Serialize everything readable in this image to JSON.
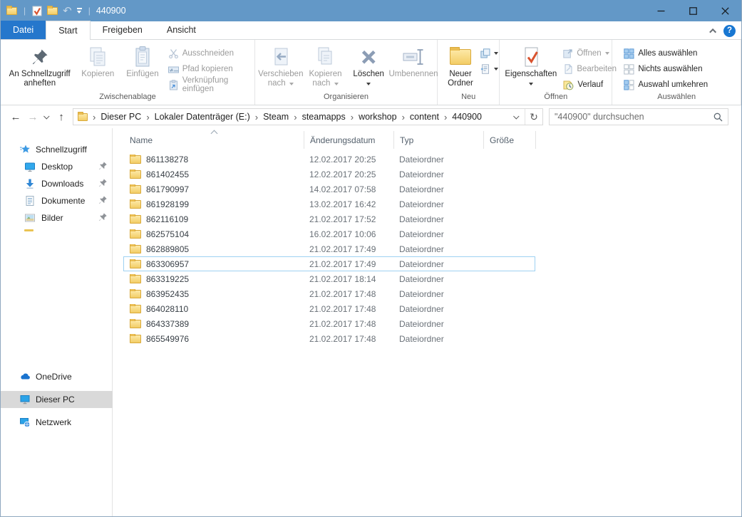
{
  "window": {
    "title": "440900"
  },
  "icons": {
    "back": "←",
    "forward": "→",
    "up": "↑",
    "undo": "↶",
    "refresh": "↻",
    "crumb_separator": "›",
    "help": "?"
  },
  "colors": {
    "titlebar": "#6398c7",
    "file_tab": "#2577cc",
    "selection_outline": "#9ed1f2",
    "folder": "#f3cd66",
    "help_accent": "#1877d2",
    "sidebar_selected": "#d9d9d9"
  },
  "tabs": {
    "datei": "Datei",
    "start": "Start",
    "freigeben": "Freigeben",
    "ansicht": "Ansicht",
    "active": "Start"
  },
  "ribbon": {
    "groups": {
      "clipboard": {
        "label": "Zwischenablage",
        "pin": "An Schnellzugriff anheften",
        "copy": "Kopieren",
        "paste": "Einfügen",
        "cut": "Ausschneiden",
        "copy_path": "Pfad kopieren",
        "paste_shortcut": "Verknüpfung einfügen"
      },
      "organize": {
        "label": "Organisieren",
        "move_to": "Verschieben nach",
        "copy_to": "Kopieren nach",
        "delete": "Löschen",
        "rename": "Umbenennen"
      },
      "new": {
        "label": "Neu",
        "new_folder": "Neuer Ordner"
      },
      "open": {
        "label": "Öffnen",
        "properties": "Eigenschaften",
        "open": "Öffnen",
        "edit": "Bearbeiten",
        "history": "Verlauf"
      },
      "select": {
        "label": "Auswählen",
        "select_all": "Alles auswählen",
        "select_none": "Nichts auswählen",
        "invert": "Auswahl umkehren"
      }
    }
  },
  "navbar": {
    "address": {
      "crumbs": [
        "Dieser PC",
        "Lokaler Datenträger (E:)",
        "Steam",
        "steamapps",
        "workshop",
        "content",
        "440900"
      ]
    },
    "search": {
      "placeholder": "\"440900\" durchsuchen"
    }
  },
  "sidebar": {
    "quick_access": {
      "label": "Schnellzugriff",
      "items": [
        {
          "label": "Desktop",
          "icon": "desktop-icon",
          "pinned": true
        },
        {
          "label": "Downloads",
          "icon": "downloads-icon",
          "pinned": true
        },
        {
          "label": "Dokumente",
          "icon": "documents-icon",
          "pinned": true
        },
        {
          "label": "Bilder",
          "icon": "pictures-icon",
          "pinned": true
        }
      ]
    },
    "one_drive": "OneDrive",
    "this_pc": "Dieser PC",
    "network": "Netzwerk",
    "selected": "Dieser PC"
  },
  "files": {
    "columns": [
      "Name",
      "Änderungsdatum",
      "Typ",
      "Größe"
    ],
    "sort_column": "Name",
    "sort_ascending": true,
    "highlighted_index": 7,
    "rows": [
      {
        "name": "861138278",
        "modified": "12.02.2017 20:25",
        "type": "Dateiordner",
        "size": ""
      },
      {
        "name": "861402455",
        "modified": "12.02.2017 20:25",
        "type": "Dateiordner",
        "size": ""
      },
      {
        "name": "861790997",
        "modified": "14.02.2017 07:58",
        "type": "Dateiordner",
        "size": ""
      },
      {
        "name": "861928199",
        "modified": "13.02.2017 16:42",
        "type": "Dateiordner",
        "size": ""
      },
      {
        "name": "862116109",
        "modified": "21.02.2017 17:52",
        "type": "Dateiordner",
        "size": ""
      },
      {
        "name": "862575104",
        "modified": "16.02.2017 10:06",
        "type": "Dateiordner",
        "size": ""
      },
      {
        "name": "862889805",
        "modified": "21.02.2017 17:49",
        "type": "Dateiordner",
        "size": ""
      },
      {
        "name": "863306957",
        "modified": "21.02.2017 17:49",
        "type": "Dateiordner",
        "size": ""
      },
      {
        "name": "863319225",
        "modified": "21.02.2017 18:14",
        "type": "Dateiordner",
        "size": ""
      },
      {
        "name": "863952435",
        "modified": "21.02.2017 17:48",
        "type": "Dateiordner",
        "size": ""
      },
      {
        "name": "864028110",
        "modified": "21.02.2017 17:48",
        "type": "Dateiordner",
        "size": ""
      },
      {
        "name": "864337389",
        "modified": "21.02.2017 17:48",
        "type": "Dateiordner",
        "size": ""
      },
      {
        "name": "865549976",
        "modified": "21.02.2017 17:48",
        "type": "Dateiordner",
        "size": ""
      }
    ]
  }
}
